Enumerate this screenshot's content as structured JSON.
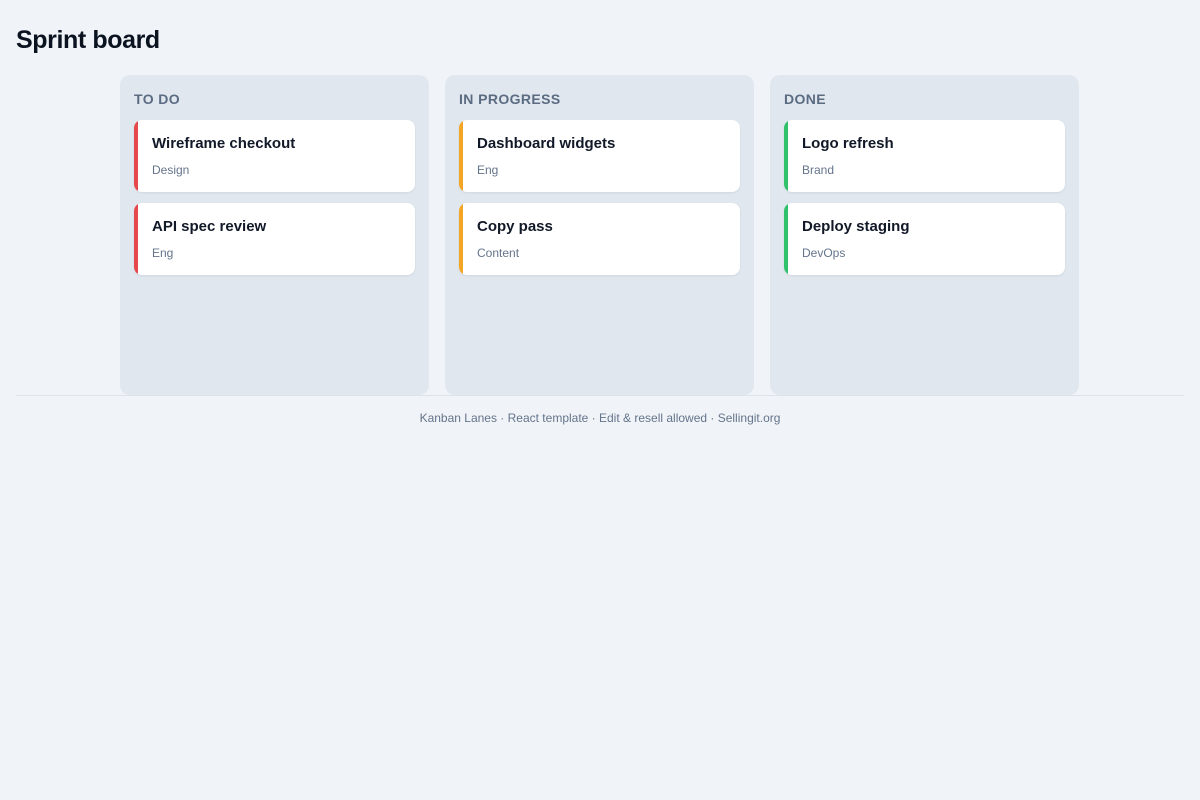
{
  "page": {
    "title": "Sprint board"
  },
  "lanes": [
    {
      "title": "TO DO",
      "accent": "#e5484d",
      "cards": [
        {
          "title": "Wireframe checkout",
          "tag": "Design"
        },
        {
          "title": "API spec review",
          "tag": "Eng"
        }
      ]
    },
    {
      "title": "IN PROGRESS",
      "accent": "#f5a524",
      "cards": [
        {
          "title": "Dashboard widgets",
          "tag": "Eng"
        },
        {
          "title": "Copy pass",
          "tag": "Content"
        }
      ]
    },
    {
      "title": "DONE",
      "accent": "#30c16b",
      "cards": [
        {
          "title": "Logo refresh",
          "tag": "Brand"
        },
        {
          "title": "Deploy staging",
          "tag": "DevOps"
        }
      ]
    }
  ],
  "footer": {
    "text": "Kanban Lanes · React template · Edit & resell allowed · Sellingit.org"
  }
}
